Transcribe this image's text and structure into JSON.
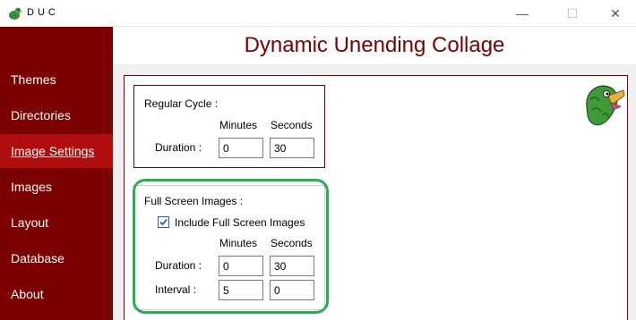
{
  "window": {
    "title": "DUC",
    "minimize_glyph": "—",
    "maximize_glyph": "☐",
    "close_glyph": "✕"
  },
  "sidebar": {
    "items": [
      {
        "label": "Themes"
      },
      {
        "label": "Directories"
      },
      {
        "label": "Image Settings"
      },
      {
        "label": "Images"
      },
      {
        "label": "Layout"
      },
      {
        "label": "Database"
      },
      {
        "label": "About"
      }
    ],
    "active_index": 2
  },
  "header": {
    "title": "Dynamic Unending Collage"
  },
  "regular_cycle": {
    "title": "Regular Cycle :",
    "minutes_header": "Minutes",
    "seconds_header": "Seconds",
    "duration_label": "Duration :",
    "duration_minutes": "0",
    "duration_seconds": "30"
  },
  "full_screen": {
    "title": "Full Screen Images :",
    "include_label": "Include Full Screen Images",
    "include_checked": true,
    "minutes_header": "Minutes",
    "seconds_header": "Seconds",
    "duration_label": "Duration :",
    "duration_minutes": "0",
    "duration_seconds": "30",
    "interval_label": "Interval :",
    "interval_minutes": "5",
    "interval_seconds": "0"
  },
  "colors": {
    "brand": "#7b0000",
    "active_nav": "#b00e0e",
    "highlight": "#2eaa55"
  },
  "icons": {
    "app": "duck-logo-icon",
    "mascot": "duck-mascot-icon"
  }
}
